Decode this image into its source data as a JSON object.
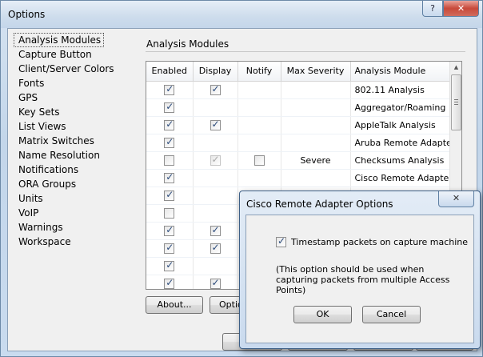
{
  "window": {
    "title": "Options",
    "help_button": "?",
    "close_button": "✕"
  },
  "nav": {
    "items": [
      {
        "label": "Analysis Modules",
        "selected": true
      },
      {
        "label": "Capture Button"
      },
      {
        "label": "Client/Server Colors"
      },
      {
        "label": "Fonts"
      },
      {
        "label": "GPS"
      },
      {
        "label": "Key Sets"
      },
      {
        "label": "List Views"
      },
      {
        "label": "Matrix Switches"
      },
      {
        "label": "Name Resolution"
      },
      {
        "label": "Notifications"
      },
      {
        "label": "ORA Groups"
      },
      {
        "label": "Units"
      },
      {
        "label": "VoIP"
      },
      {
        "label": "Warnings"
      },
      {
        "label": "Workspace"
      }
    ]
  },
  "panel": {
    "title": "Analysis Modules",
    "columns": [
      "Enabled",
      "Display",
      "Notify",
      "Max Severity",
      "Analysis Module"
    ],
    "rows": [
      {
        "enabled": true,
        "display": true,
        "notify": null,
        "severity": "",
        "module": "802.11 Analysis"
      },
      {
        "enabled": true,
        "display": null,
        "notify": null,
        "severity": "",
        "module": "Aggregator/Roaming"
      },
      {
        "enabled": true,
        "display": true,
        "notify": null,
        "severity": "",
        "module": "AppleTalk Analysis"
      },
      {
        "enabled": true,
        "display": null,
        "notify": null,
        "severity": "",
        "module": "Aruba Remote Adapter"
      },
      {
        "enabled": false,
        "display": "dim",
        "notify": false,
        "severity": "Severe",
        "module": "Checksums Analysis"
      },
      {
        "enabled": true,
        "display": null,
        "notify": null,
        "severity": "",
        "module": "Cisco Remote Adapter"
      },
      {
        "enabled": true,
        "display": null,
        "notify": null,
        "severity": "",
        "module": ""
      },
      {
        "enabled": false,
        "display": null,
        "notify": null,
        "severity": "",
        "module": ""
      },
      {
        "enabled": true,
        "display": true,
        "notify": null,
        "severity": "",
        "module": ""
      },
      {
        "enabled": true,
        "display": true,
        "notify": null,
        "severity": "",
        "module": ""
      },
      {
        "enabled": true,
        "display": null,
        "notify": null,
        "severity": "",
        "module": ""
      },
      {
        "enabled": true,
        "display": true,
        "notify": null,
        "severity": "",
        "module": ""
      }
    ],
    "about_button": "About...",
    "options_button": "Optio"
  },
  "dialog": {
    "title": "Cisco Remote Adapter Options",
    "close_button": "✕",
    "checkbox_label": "Timestamp packets on capture machine",
    "checkbox_checked": true,
    "note": "(This option should be used when capturing packets from multiple Access Points)",
    "ok_button": "OK",
    "cancel_button": "Cancel"
  },
  "colors": {
    "window_frame": "#c9dbef",
    "client_bg": "#f0f0f0",
    "grid_bg": "#ffffff"
  }
}
